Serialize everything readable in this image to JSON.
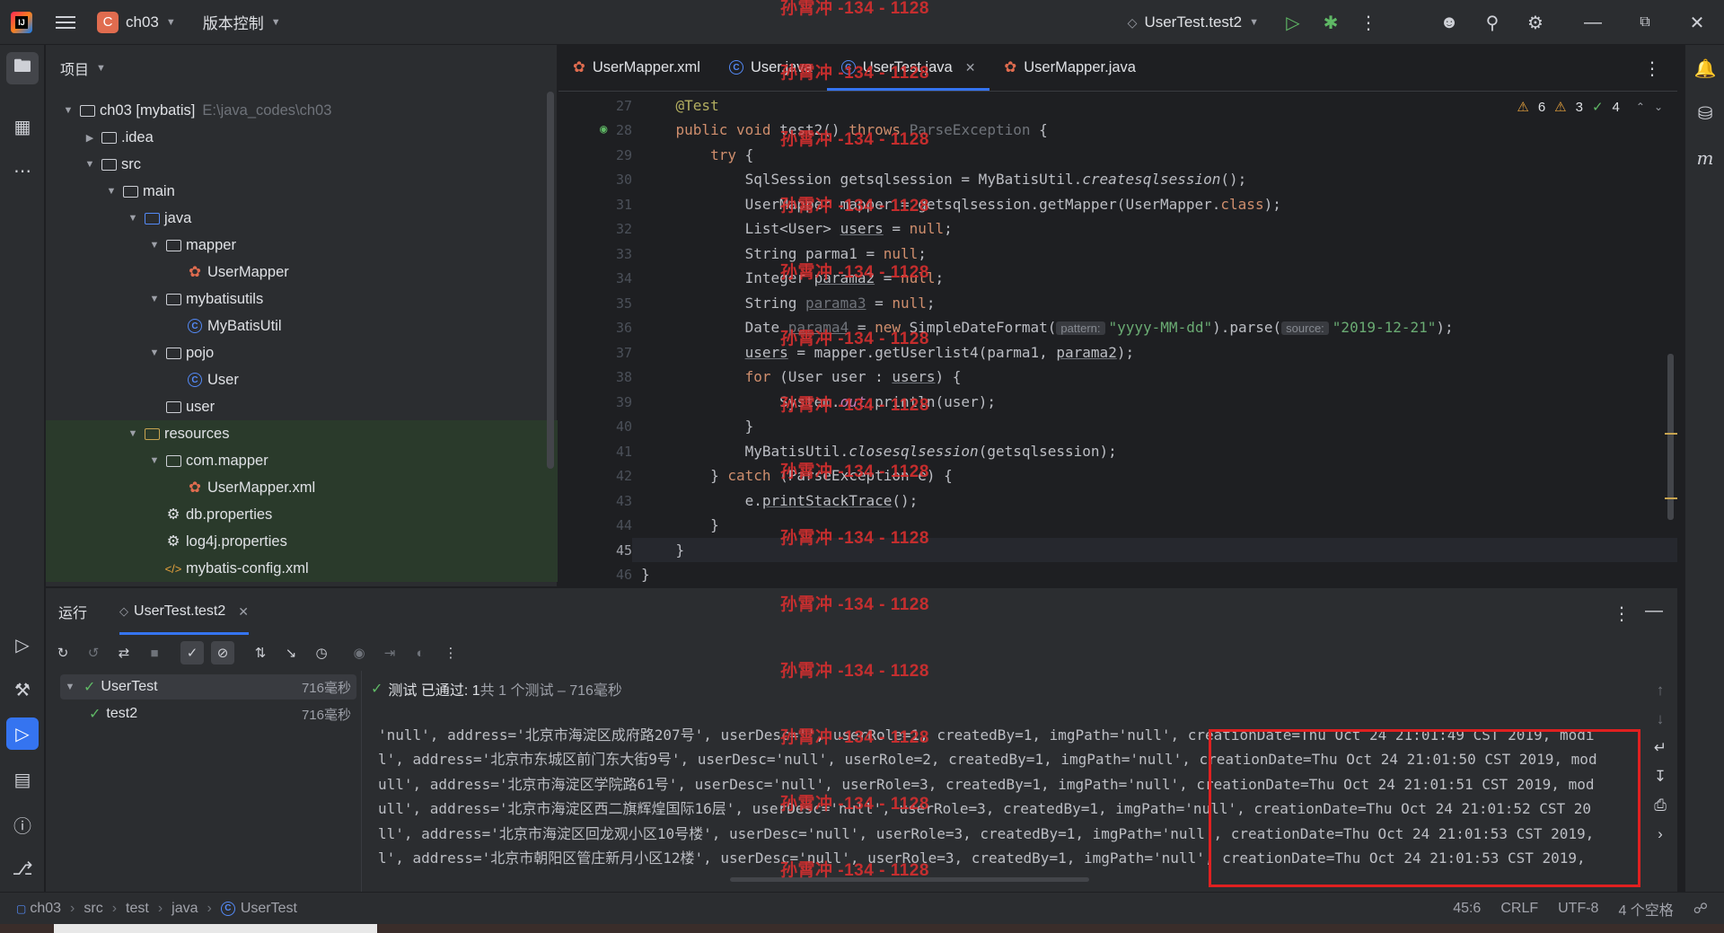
{
  "titlebar": {
    "project_badge": "C",
    "project_name": "ch03",
    "vcs": "版本控制",
    "run_config": "UserTest.test2"
  },
  "project_panel": {
    "title": "项目",
    "tree": [
      {
        "label": "ch03 [mybatis]",
        "path": "E:\\java_codes\\ch03"
      },
      {
        "label": ".idea"
      },
      {
        "label": "src"
      },
      {
        "label": "main"
      },
      {
        "label": "java"
      },
      {
        "label": "mapper"
      },
      {
        "label": "UserMapper"
      },
      {
        "label": "mybatisutils"
      },
      {
        "label": "MyBatisUtil"
      },
      {
        "label": "pojo"
      },
      {
        "label": "User"
      },
      {
        "label": "user"
      },
      {
        "label": "resources"
      },
      {
        "label": "com.mapper"
      },
      {
        "label": "UserMapper.xml"
      },
      {
        "label": "db.properties"
      },
      {
        "label": "log4j.properties"
      },
      {
        "label": "mybatis-config.xml"
      }
    ]
  },
  "editor": {
    "tabs": [
      "UserMapper.xml",
      "User.java",
      "UserTest.java",
      "UserMapper.java"
    ],
    "active_tab": "UserTest.java",
    "problems": {
      "warnings": "6",
      "weak": "3",
      "ok": "4"
    },
    "line_numbers": [
      "27",
      "28",
      "29",
      "30",
      "31",
      "32",
      "33",
      "34",
      "35",
      "36",
      "37",
      "38",
      "39",
      "40",
      "41",
      "42",
      "43",
      "44",
      "45",
      "46"
    ],
    "current_line": "45",
    "hint_pattern": "pattern:",
    "hint_source": "source:"
  },
  "watermark": "孙霄冲 -134 - 1128",
  "run_panel": {
    "title": "运行",
    "tab": "UserTest.test2",
    "tests": [
      {
        "name": "UserTest",
        "time": "716毫秒"
      },
      {
        "name": "test2",
        "time": "716毫秒"
      }
    ],
    "status": "测试 已通过: 1",
    "status_detail": "共 1 个测试 – 716毫秒",
    "console_lines": [
      "'null', address='北京市海淀区成府路207号', userDesc='', userRole=1, createdBy=1, imgPath='null', creationDate=Thu Oct 24 21:01:49 CST 2019, modi",
      "l', address='北京市东城区前门东大街9号', userDesc='null', userRole=2, createdBy=1, imgPath='null', creationDate=Thu Oct 24 21:01:50 CST 2019, mod",
      "ull', address='北京市海淀区学院路61号', userDesc='null', userRole=3, createdBy=1, imgPath='null', creationDate=Thu Oct 24 21:01:51 CST 2019, mod",
      "ull', address='北京市海淀区西二旗辉煌国际16层', userDesc='null', userRole=3, createdBy=1, imgPath='null', creationDate=Thu Oct 24 21:01:52 CST 20",
      "ll', address='北京市海淀区回龙观小区10号楼', userDesc='null', userRole=3, createdBy=1, imgPath='null', creationDate=Thu Oct 24 21:01:53 CST 2019,",
      "l', address='北京市朝阳区管庄新月小区12楼', userDesc='null', userRole=3, createdBy=1, imgPath='null', creationDate=Thu Oct 24 21:01:53 CST 2019,"
    ]
  },
  "statusbar": {
    "breadcrumb": [
      "ch03",
      "src",
      "test",
      "java",
      "UserTest"
    ],
    "position": "45:6",
    "line_sep": "CRLF",
    "encoding": "UTF-8",
    "indent": "4 个空格"
  },
  "colors": {
    "accent": "#3574f0",
    "pass": "#5fb865",
    "highlight_box": "#e02020",
    "watermark": "#d62f2f"
  }
}
